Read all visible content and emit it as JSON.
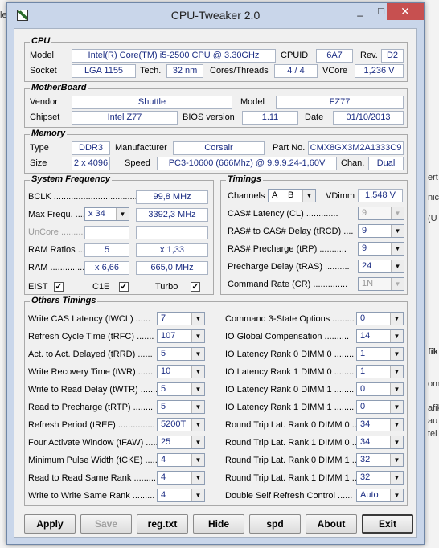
{
  "window": {
    "title": "CPU-Tweaker 2.0",
    "min": "_",
    "max": "□",
    "close": "✕"
  },
  "cpu": {
    "title": "CPU",
    "model_label": "Model",
    "model": "Intel(R) Core(TM) i5-2500 CPU @ 3.30GHz",
    "cpuid_label": "CPUID",
    "cpuid": "6A7",
    "rev_label": "Rev.",
    "rev": "D2",
    "socket_label": "Socket",
    "socket": "LGA 1155",
    "tech_label": "Tech.",
    "tech": "32 nm",
    "cores_label": "Cores/Threads",
    "cores": "4 / 4",
    "vcore_label": "VCore",
    "vcore": "1,236 V"
  },
  "mb": {
    "title": "MotherBoard",
    "vendor_label": "Vendor",
    "vendor": "Shuttle",
    "model_label": "Model",
    "model": "FZ77",
    "chipset_label": "Chipset",
    "chipset": "Intel Z77",
    "bios_label": "BIOS version",
    "bios": "1.11",
    "date_label": "Date",
    "date": "01/10/2013"
  },
  "mem": {
    "title": "Memory",
    "type_label": "Type",
    "type": "DDR3",
    "manufacturer_label": "Manufacturer",
    "manufacturer": "Corsair",
    "part_label": "Part No.",
    "part": "CMX8GX3M2A1333C9",
    "size_label": "Size",
    "size": "2 x 4096",
    "speed_label": "Speed",
    "speed": "PC3-10600 (666Mhz) @ 9.9.9.24-1,60V",
    "chan_label": "Chan.",
    "chan": "Dual"
  },
  "sysfreq": {
    "title": "System Frequency",
    "bclk_label": "BCLK ....................................",
    "bclk": "99,8 MHz",
    "maxf_label": "Max Frequ. ....",
    "maxf_mult": "x 34",
    "maxf": "3392,3 MHz",
    "uncore_label": "UnCore ...............",
    "ramratio_label": "RAM Ratios ....",
    "ramratio_a": "5",
    "ramratio_b": "x 1,33",
    "ram_label": "RAM ................",
    "ram_mult": "x 6,66",
    "ram": "665,0 MHz",
    "eist_label": "EIST",
    "c1e_label": "C1E",
    "turbo_label": "Turbo",
    "check": "✓"
  },
  "timings": {
    "title": "Timings",
    "channels_label": "Channels",
    "channel_a": "A",
    "channel_b": "B",
    "vdimm_label": "VDimm",
    "vdimm": "1,548 V",
    "rows": [
      {
        "label": "CAS# Latency (CL) .............",
        "value": "9"
      },
      {
        "label": "RAS# to CAS# Delay (tRCD) ....",
        "value": "9"
      },
      {
        "label": "RAS# Precharge (tRP) ...........",
        "value": "9"
      },
      {
        "label": "Precharge Delay (tRAS) ..........",
        "value": "24"
      },
      {
        "label": "Command Rate (CR) ..............",
        "value": "1N"
      }
    ]
  },
  "other": {
    "title": "Others Timings",
    "left": [
      {
        "label": "Write CAS Latency (tWCL) ......",
        "value": "7"
      },
      {
        "label": "Refresh Cycle Time (tRFC) .......",
        "value": "107"
      },
      {
        "label": "Act. to Act. Delayed (tRRD) ......",
        "value": "5"
      },
      {
        "label": "Write Recovery Time (tWR) ......",
        "value": "10"
      },
      {
        "label": "Write to Read Delay (tWTR) .......",
        "value": "5"
      },
      {
        "label": "Read to Precharge (tRTP) ........",
        "value": "5"
      },
      {
        "label": "Refresh Period (tREF) ...............",
        "value": "5200T"
      },
      {
        "label": "Four Activate Window (tFAW) .....",
        "value": "25"
      },
      {
        "label": "Minimum Pulse Width (tCKE) ......",
        "value": "4"
      },
      {
        "label": "Read to Read Same Rank .........",
        "value": "4"
      },
      {
        "label": "Write to Write Same Rank .........",
        "value": "4"
      }
    ],
    "right": [
      {
        "label": "Command 3-State Options .........",
        "value": "0"
      },
      {
        "label": "IO Global Compensation ..........",
        "value": "14"
      },
      {
        "label": "IO Latency Rank 0 DIMM 0 ........",
        "value": "1"
      },
      {
        "label": "IO Latency Rank 1 DIMM 0 ........",
        "value": "1"
      },
      {
        "label": "IO Latency Rank 0 DIMM 1 ........",
        "value": "0"
      },
      {
        "label": "IO Latency Rank 1 DIMM 1 ........",
        "value": "0"
      },
      {
        "label": "Round Trip Lat. Rank 0 DIMM 0 ....",
        "value": "34"
      },
      {
        "label": "Round Trip Lat. Rank 1 DIMM 0 ....",
        "value": "34"
      },
      {
        "label": "Round Trip Lat. Rank 0 DIMM 1 ....",
        "value": "32"
      },
      {
        "label": "Round Trip Lat. Rank 1 DIMM 1 ....",
        "value": "32"
      },
      {
        "label": "Double Self Refresh Control ......",
        "value": "Auto"
      }
    ]
  },
  "buttons": {
    "apply": "Apply",
    "save": "Save",
    "regtxt": "reg.txt",
    "hide": "Hide",
    "spd": "spd",
    "about": "About",
    "exit": "Exit"
  },
  "background": {
    "left_edge": "ler",
    "r1": "ert",
    "r2": "nic",
    "r3": "(U",
    "r4": "fik",
    "r5": "om",
    "r6": "afik",
    "r7": "au",
    "r8": "tei"
  }
}
